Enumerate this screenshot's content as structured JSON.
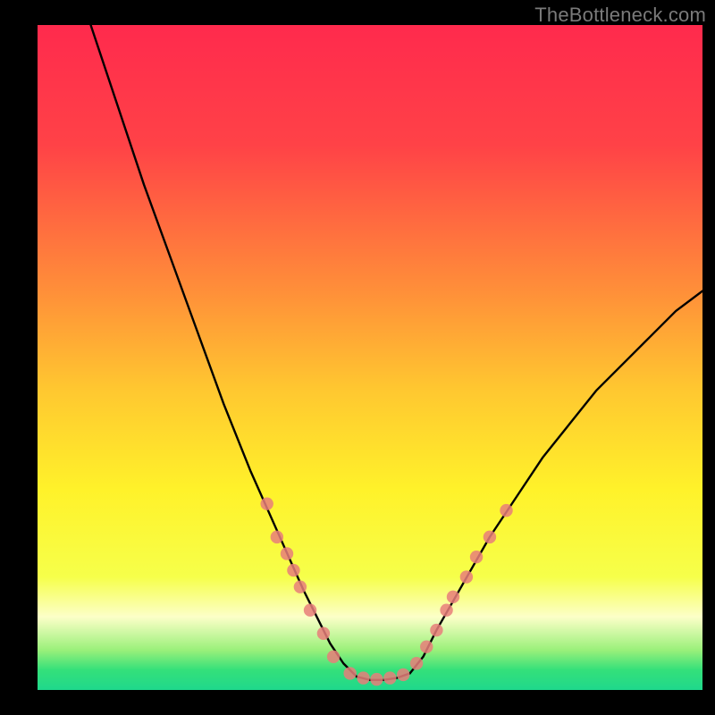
{
  "watermark": "TheBottleneck.com",
  "chart_data": {
    "type": "line",
    "title": "",
    "xlabel": "",
    "ylabel": "",
    "xlim": [
      0,
      100
    ],
    "ylim": [
      0,
      100
    ],
    "grid": false,
    "legend": false,
    "background_gradient": {
      "stops": [
        {
          "offset": 0.0,
          "color": "#ff2a4d"
        },
        {
          "offset": 0.18,
          "color": "#ff4247"
        },
        {
          "offset": 0.4,
          "color": "#ff8f39"
        },
        {
          "offset": 0.55,
          "color": "#ffc830"
        },
        {
          "offset": 0.7,
          "color": "#fff22a"
        },
        {
          "offset": 0.83,
          "color": "#f6ff4a"
        },
        {
          "offset": 0.89,
          "color": "#fcffc8"
        },
        {
          "offset": 0.94,
          "color": "#9af07a"
        },
        {
          "offset": 0.97,
          "color": "#34e07a"
        },
        {
          "offset": 1.0,
          "color": "#1fd88c"
        }
      ]
    },
    "series": [
      {
        "name": "bottleneck-curve-left",
        "type": "line",
        "color": "#000000",
        "x": [
          8,
          12,
          16,
          20,
          24,
          28,
          32,
          36,
          40,
          42,
          44,
          46,
          48
        ],
        "y": [
          100,
          88,
          76,
          65,
          54,
          43,
          33,
          24,
          15,
          11,
          7,
          4,
          2
        ]
      },
      {
        "name": "bottleneck-curve-bottom",
        "type": "line",
        "color": "#000000",
        "x": [
          48,
          50,
          52,
          54,
          56
        ],
        "y": [
          2,
          1.5,
          1.5,
          1.8,
          2.5
        ]
      },
      {
        "name": "bottleneck-curve-right",
        "type": "line",
        "color": "#000000",
        "x": [
          56,
          58,
          60,
          64,
          68,
          72,
          76,
          80,
          84,
          88,
          92,
          96,
          100
        ],
        "y": [
          2.5,
          5,
          9,
          16,
          23,
          29,
          35,
          40,
          45,
          49,
          53,
          57,
          60
        ]
      }
    ],
    "markers": [
      {
        "name": "highlight-points",
        "color": "#e77e7a",
        "points": [
          {
            "x": 34.5,
            "y": 28
          },
          {
            "x": 36,
            "y": 23
          },
          {
            "x": 37.5,
            "y": 20.5
          },
          {
            "x": 38.5,
            "y": 18
          },
          {
            "x": 39.5,
            "y": 15.5
          },
          {
            "x": 41,
            "y": 12
          },
          {
            "x": 43,
            "y": 8.5
          },
          {
            "x": 44.5,
            "y": 5
          },
          {
            "x": 47,
            "y": 2.5
          },
          {
            "x": 49,
            "y": 1.8
          },
          {
            "x": 51,
            "y": 1.6
          },
          {
            "x": 53,
            "y": 1.8
          },
          {
            "x": 55,
            "y": 2.3
          },
          {
            "x": 57,
            "y": 4
          },
          {
            "x": 58.5,
            "y": 6.5
          },
          {
            "x": 60,
            "y": 9
          },
          {
            "x": 61.5,
            "y": 12
          },
          {
            "x": 62.5,
            "y": 14
          },
          {
            "x": 64.5,
            "y": 17
          },
          {
            "x": 66,
            "y": 20
          },
          {
            "x": 68,
            "y": 23
          },
          {
            "x": 70.5,
            "y": 27
          }
        ]
      }
    ]
  }
}
